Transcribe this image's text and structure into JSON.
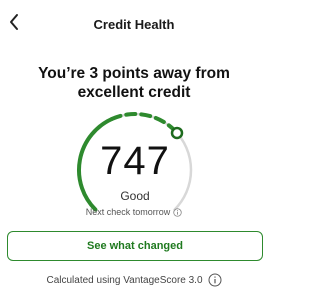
{
  "header": {
    "title": "Credit Health",
    "back_icon": "chevron-left-icon"
  },
  "headline": "You’re 3 points away from excellent credit",
  "score": {
    "value": "747",
    "rating": "Good",
    "next_check": "Next check tomorrow",
    "gauge_fraction": 0.68,
    "color": "#2e8a2e",
    "track_color": "#d8d8d8"
  },
  "cta": {
    "label": "See what changed"
  },
  "footer": {
    "text": "Calculated using VantageScore 3.0",
    "info_icon": "info-icon"
  }
}
